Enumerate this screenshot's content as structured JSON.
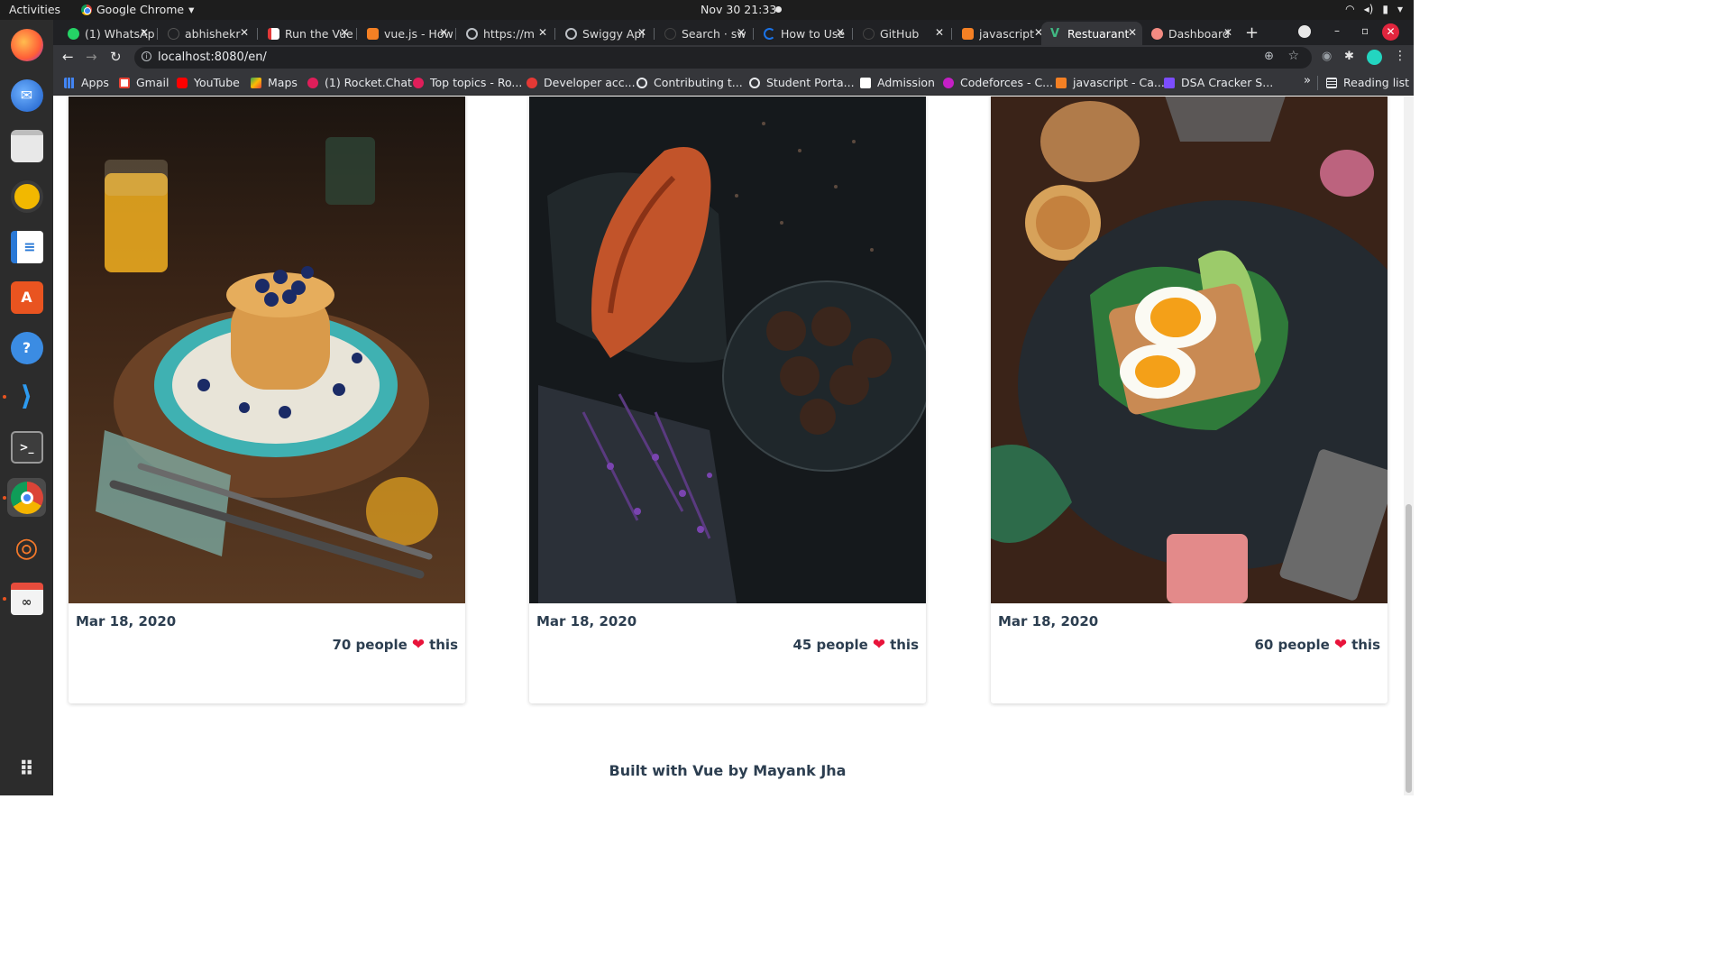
{
  "system": {
    "activities": "Activities",
    "app_name": "Google Chrome",
    "clock": "Nov 30  21:33"
  },
  "tabs": [
    {
      "label": "(1) WhatsApp",
      "favicon_color": "#25d366"
    },
    {
      "label": "abhishekr",
      "favicon_color": "#202124"
    },
    {
      "label": "Run the Vue",
      "favicon_color": "#e23838"
    },
    {
      "label": "vue.js - How",
      "favicon_color": "#f48024"
    },
    {
      "label": "https://m",
      "favicon_color": "#bdc1c6"
    },
    {
      "label": "Swiggy Api",
      "favicon_color": "#bdc1c6"
    },
    {
      "label": "Search · sw",
      "favicon_color": "#202124"
    },
    {
      "label": "How to Use",
      "favicon_color": "#1a73e8"
    },
    {
      "label": "GitHub",
      "favicon_color": "#202124"
    },
    {
      "label": "javascript",
      "favicon_color": "#f48024"
    },
    {
      "label": "Restuarant",
      "favicon_color": "#41b883",
      "active": true
    },
    {
      "label": "Dashboard",
      "favicon_color": "#f28b82"
    }
  ],
  "omnibox": {
    "url": "localhost:8080/en/"
  },
  "bookmarks": [
    {
      "label": "Apps",
      "color": "#4285f4"
    },
    {
      "label": "Gmail",
      "color": "#ea4335"
    },
    {
      "label": "YouTube",
      "color": "#ff0000"
    },
    {
      "label": "Maps",
      "color": "#34a853"
    },
    {
      "label": "(1) Rocket.Chat",
      "color": "#e01e5a"
    },
    {
      "label": "Top topics - Ro...",
      "color": "#e01e5a"
    },
    {
      "label": "Developer acc...",
      "color": "#e53935"
    },
    {
      "label": "Contributing t...",
      "color": "#e8eaed"
    },
    {
      "label": "Student Porta...",
      "color": "#e8eaed"
    },
    {
      "label": "Admission",
      "color": "#ffffff"
    },
    {
      "label": "Codeforces - C...",
      "color": "#c51fc5"
    },
    {
      "label": "javascript - Ca...",
      "color": "#f48024"
    },
    {
      "label": "DSA Cracker S...",
      "color": "#7c4dff"
    }
  ],
  "reading_list": "Reading list",
  "cards": [
    {
      "date": "Mar 18, 2020",
      "likes_count": "70 people",
      "likes_suffix": "this",
      "photo": "pancakes-icon"
    },
    {
      "date": "Mar 18, 2020",
      "likes_count": "45 people",
      "likes_suffix": "this",
      "photo": "croissant-icon"
    },
    {
      "date": "Mar 18, 2020",
      "likes_count": "60 people",
      "likes_suffix": "this",
      "photo": "egg-toast-icon"
    }
  ],
  "footer": "Built with Vue by Mayank Jha",
  "colors": {
    "heart": "#e8133a",
    "text_dark": "#2c3e50",
    "chrome_dark": "#35363a"
  }
}
